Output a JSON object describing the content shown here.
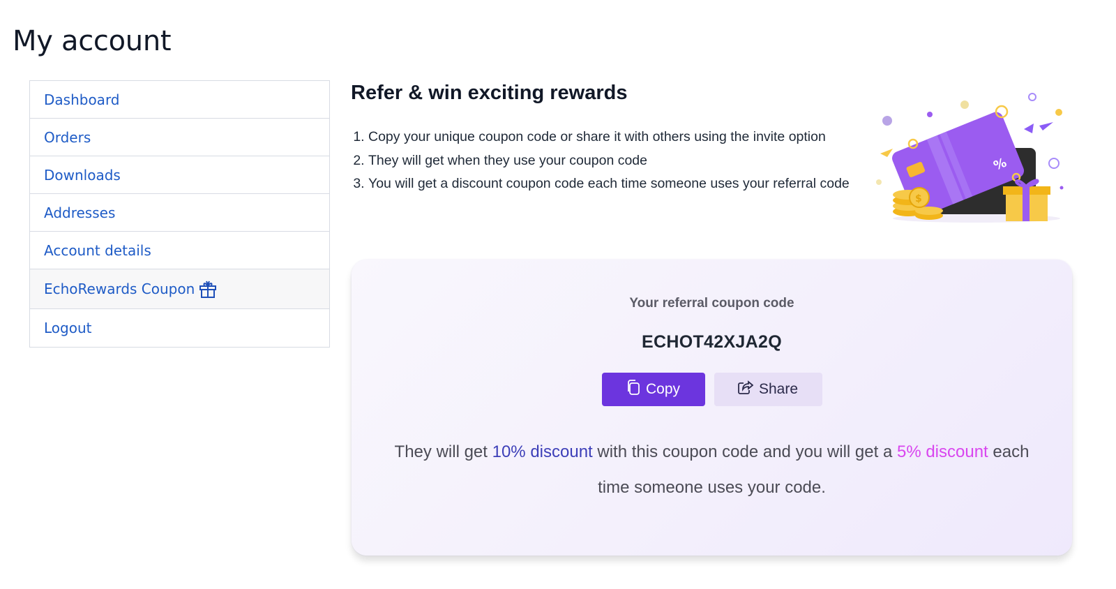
{
  "page": {
    "title": "My account"
  },
  "nav": {
    "items": [
      {
        "label": "Dashboard"
      },
      {
        "label": "Orders"
      },
      {
        "label": "Downloads"
      },
      {
        "label": "Addresses"
      },
      {
        "label": "Account details"
      },
      {
        "label": "EchoRewards Coupon",
        "icon": "gift-icon",
        "active": true
      },
      {
        "label": "Logout"
      }
    ]
  },
  "referral": {
    "heading": "Refer & win exciting rewards",
    "steps": [
      "Copy your unique coupon code or share it with others using the invite option",
      "They will get when they use your coupon code",
      "You will get a discount coupon code each time someone uses your referral code"
    ],
    "illustration": "credit-card-rewards-illustration"
  },
  "coupon": {
    "label": "Your referral coupon code",
    "code": "ECHOT42XJA2Q",
    "copy_label": "Copy",
    "share_label": "Share",
    "desc_part1": "They will get ",
    "their_discount": "10% discount",
    "desc_part2": " with this coupon code and you will get a ",
    "your_discount": "5% discount",
    "desc_part3": " each time someone uses your code.",
    "colors": {
      "primary": "#6c35de",
      "secondary": "#e7dff6",
      "their_discount": "#3d3fb8",
      "your_discount": "#d946ef"
    }
  }
}
